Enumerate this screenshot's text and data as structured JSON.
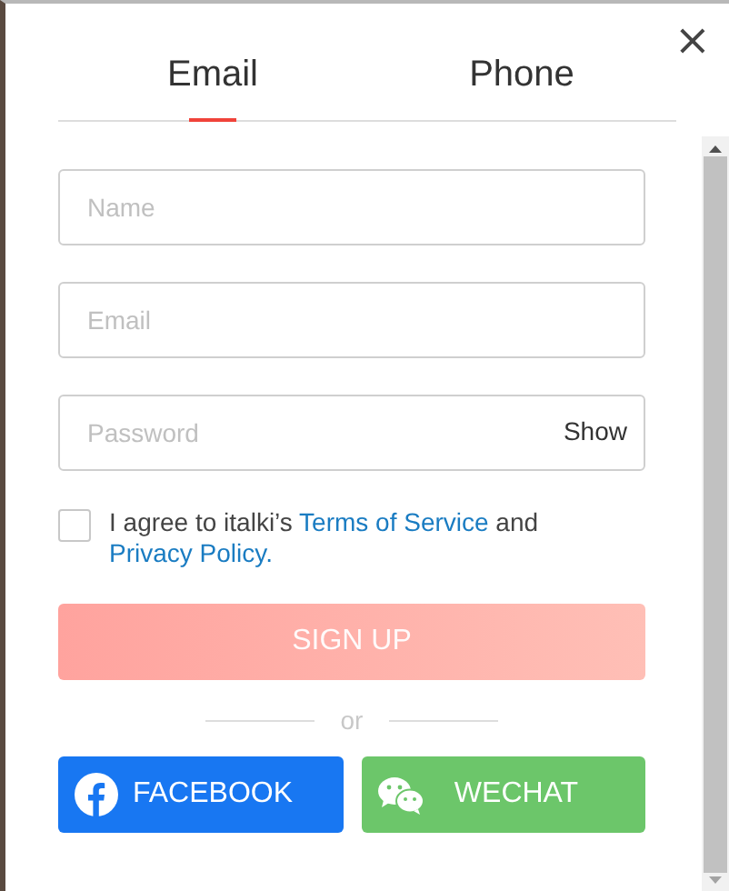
{
  "close_button": "×",
  "tabs": [
    {
      "label": "Email",
      "selected": true
    },
    {
      "label": "Phone",
      "selected": false
    }
  ],
  "fields": [
    {
      "placeholder": "Name"
    },
    {
      "placeholder": "Email"
    },
    {
      "placeholder": "Password",
      "toggle": "Show"
    }
  ],
  "agreement": {
    "checked": false,
    "parts": [
      {
        "kind": "plain",
        "text": "I agree to italki’s "
      },
      {
        "kind": "link",
        "text": "Terms of Service"
      },
      {
        "kind": "plain",
        "text": " and "
      },
      {
        "kind": "link",
        "text": "Privacy Policy."
      }
    ]
  },
  "signup_button": {
    "label": "SIGN UP",
    "disabled": true
  },
  "divider_text": "or",
  "social_buttons": [
    {
      "kind": "facebook",
      "label": "FACEBOOK"
    },
    {
      "kind": "wechat",
      "label": "WECHAT"
    }
  ]
}
